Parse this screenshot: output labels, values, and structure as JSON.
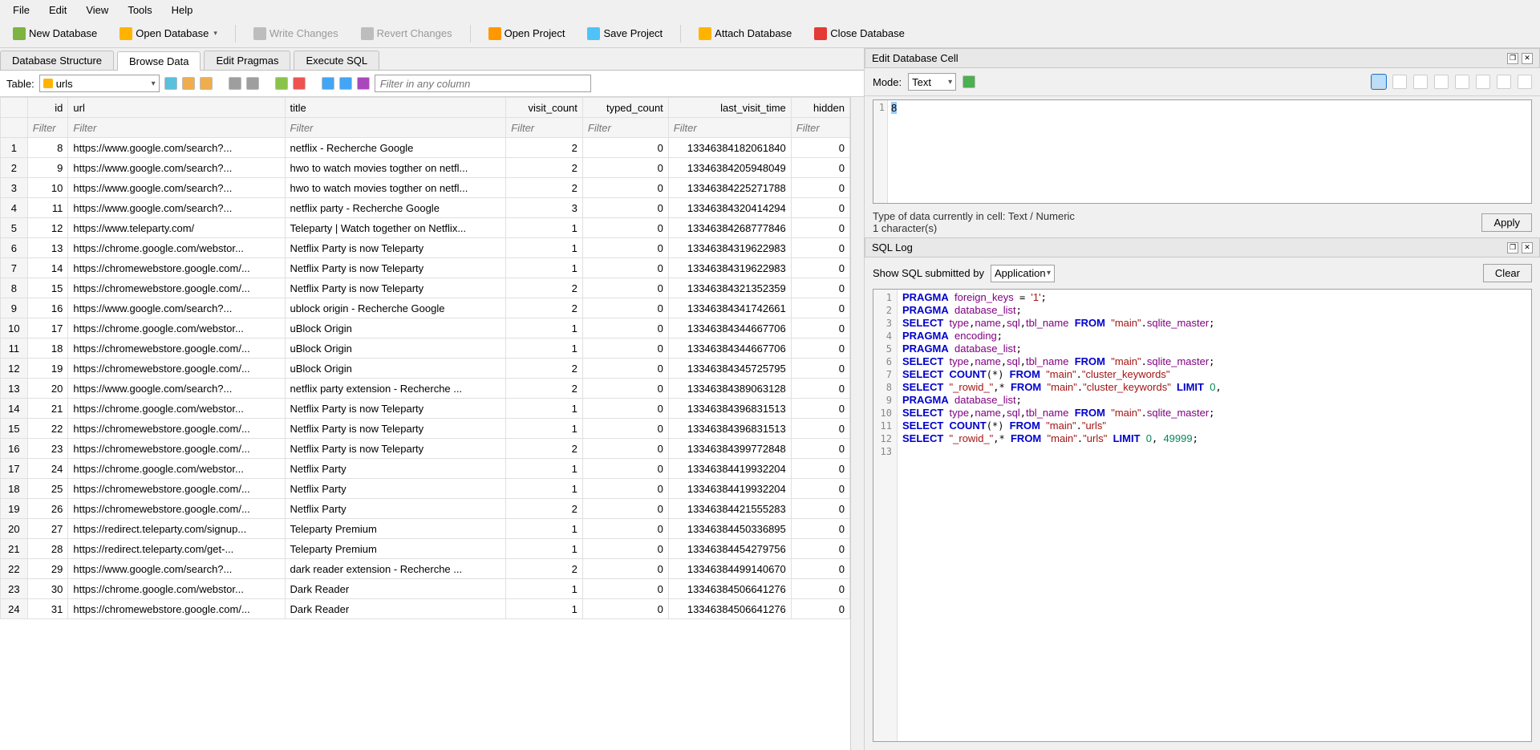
{
  "menu": {
    "file": "File",
    "edit": "Edit",
    "view": "View",
    "tools": "Tools",
    "help": "Help"
  },
  "toolbar": {
    "new_database": "New Database",
    "open_database": "Open Database",
    "write_changes": "Write Changes",
    "revert_changes": "Revert Changes",
    "open_project": "Open Project",
    "save_project": "Save Project",
    "attach_database": "Attach Database",
    "close_database": "Close Database"
  },
  "tabs": {
    "structure": "Database Structure",
    "browse": "Browse Data",
    "pragmas": "Edit Pragmas",
    "sql": "Execute SQL"
  },
  "browse": {
    "table_label": "Table:",
    "table_selected": "urls",
    "filter_any_placeholder": "Filter in any column",
    "headers": {
      "id": "id",
      "url": "url",
      "title": "title",
      "visit_count": "visit_count",
      "typed_count": "typed_count",
      "last_visit_time": "last_visit_time",
      "hidden": "hidden"
    },
    "filter_placeholder": "Filter"
  },
  "rows": [
    {
      "n": 1,
      "id": 8,
      "url": "https://www.google.com/search?...",
      "title": "netflix - Recherche Google",
      "vc": 2,
      "tc": 0,
      "lvt": "13346384182061840",
      "hid": 0
    },
    {
      "n": 2,
      "id": 9,
      "url": "https://www.google.com/search?...",
      "title": "hwo to watch movies togther on netfl...",
      "vc": 2,
      "tc": 0,
      "lvt": "13346384205948049",
      "hid": 0
    },
    {
      "n": 3,
      "id": 10,
      "url": "https://www.google.com/search?...",
      "title": "hwo to watch movies togther on netfl...",
      "vc": 2,
      "tc": 0,
      "lvt": "13346384225271788",
      "hid": 0
    },
    {
      "n": 4,
      "id": 11,
      "url": "https://www.google.com/search?...",
      "title": "netflix party - Recherche Google",
      "vc": 3,
      "tc": 0,
      "lvt": "13346384320414294",
      "hid": 0
    },
    {
      "n": 5,
      "id": 12,
      "url": "https://www.teleparty.com/",
      "title": "Teleparty | Watch together on Netflix...",
      "vc": 1,
      "tc": 0,
      "lvt": "13346384268777846",
      "hid": 0
    },
    {
      "n": 6,
      "id": 13,
      "url": "https://chrome.google.com/webstor...",
      "title": "Netflix Party is now Teleparty",
      "vc": 1,
      "tc": 0,
      "lvt": "13346384319622983",
      "hid": 0
    },
    {
      "n": 7,
      "id": 14,
      "url": "https://chromewebstore.google.com/...",
      "title": "Netflix Party is now Teleparty",
      "vc": 1,
      "tc": 0,
      "lvt": "13346384319622983",
      "hid": 0
    },
    {
      "n": 8,
      "id": 15,
      "url": "https://chromewebstore.google.com/...",
      "title": "Netflix Party is now Teleparty",
      "vc": 2,
      "tc": 0,
      "lvt": "13346384321352359",
      "hid": 0
    },
    {
      "n": 9,
      "id": 16,
      "url": "https://www.google.com/search?...",
      "title": "ublock origin - Recherche Google",
      "vc": 2,
      "tc": 0,
      "lvt": "13346384341742661",
      "hid": 0
    },
    {
      "n": 10,
      "id": 17,
      "url": "https://chrome.google.com/webstor...",
      "title": "uBlock Origin",
      "vc": 1,
      "tc": 0,
      "lvt": "13346384344667706",
      "hid": 0
    },
    {
      "n": 11,
      "id": 18,
      "url": "https://chromewebstore.google.com/...",
      "title": "uBlock Origin",
      "vc": 1,
      "tc": 0,
      "lvt": "13346384344667706",
      "hid": 0
    },
    {
      "n": 12,
      "id": 19,
      "url": "https://chromewebstore.google.com/...",
      "title": "uBlock Origin",
      "vc": 2,
      "tc": 0,
      "lvt": "13346384345725795",
      "hid": 0
    },
    {
      "n": 13,
      "id": 20,
      "url": "https://www.google.com/search?...",
      "title": "netflix party extension - Recherche ...",
      "vc": 2,
      "tc": 0,
      "lvt": "13346384389063128",
      "hid": 0
    },
    {
      "n": 14,
      "id": 21,
      "url": "https://chrome.google.com/webstor...",
      "title": "Netflix Party is now Teleparty",
      "vc": 1,
      "tc": 0,
      "lvt": "13346384396831513",
      "hid": 0
    },
    {
      "n": 15,
      "id": 22,
      "url": "https://chromewebstore.google.com/...",
      "title": "Netflix Party is now Teleparty",
      "vc": 1,
      "tc": 0,
      "lvt": "13346384396831513",
      "hid": 0
    },
    {
      "n": 16,
      "id": 23,
      "url": "https://chromewebstore.google.com/...",
      "title": "Netflix Party is now Teleparty",
      "vc": 2,
      "tc": 0,
      "lvt": "13346384399772848",
      "hid": 0
    },
    {
      "n": 17,
      "id": 24,
      "url": "https://chrome.google.com/webstor...",
      "title": "Netflix Party",
      "vc": 1,
      "tc": 0,
      "lvt": "13346384419932204",
      "hid": 0
    },
    {
      "n": 18,
      "id": 25,
      "url": "https://chromewebstore.google.com/...",
      "title": "Netflix Party",
      "vc": 1,
      "tc": 0,
      "lvt": "13346384419932204",
      "hid": 0
    },
    {
      "n": 19,
      "id": 26,
      "url": "https://chromewebstore.google.com/...",
      "title": "Netflix Party",
      "vc": 2,
      "tc": 0,
      "lvt": "13346384421555283",
      "hid": 0
    },
    {
      "n": 20,
      "id": 27,
      "url": "https://redirect.teleparty.com/signup...",
      "title": "Teleparty Premium",
      "vc": 1,
      "tc": 0,
      "lvt": "13346384450336895",
      "hid": 0
    },
    {
      "n": 21,
      "id": 28,
      "url": "https://redirect.teleparty.com/get-...",
      "title": "Teleparty Premium",
      "vc": 1,
      "tc": 0,
      "lvt": "13346384454279756",
      "hid": 0
    },
    {
      "n": 22,
      "id": 29,
      "url": "https://www.google.com/search?...",
      "title": "dark reader extension - Recherche ...",
      "vc": 2,
      "tc": 0,
      "lvt": "13346384499140670",
      "hid": 0
    },
    {
      "n": 23,
      "id": 30,
      "url": "https://chrome.google.com/webstor...",
      "title": "Dark Reader",
      "vc": 1,
      "tc": 0,
      "lvt": "13346384506641276",
      "hid": 0
    },
    {
      "n": 24,
      "id": 31,
      "url": "https://chromewebstore.google.com/...",
      "title": "Dark Reader",
      "vc": 1,
      "tc": 0,
      "lvt": "13346384506641276",
      "hid": 0
    }
  ],
  "editcell": {
    "title": "Edit Database Cell",
    "mode_label": "Mode:",
    "mode_value": "Text",
    "content": "8",
    "line": "1",
    "type_info": "Type of data currently in cell: Text / Numeric",
    "char_info": "1 character(s)",
    "apply": "Apply"
  },
  "sqllog": {
    "title": "SQL Log",
    "show_label": "Show SQL submitted by",
    "source": "Application",
    "clear": "Clear",
    "lines": [
      {
        "html": "<span class='kw'>PRAGMA</span> <span class='ident'>foreign_keys</span> = <span class='str'>'1'</span>;"
      },
      {
        "html": "<span class='kw'>PRAGMA</span> <span class='ident'>database_list</span>;"
      },
      {
        "html": "<span class='kw'>SELECT</span> <span class='ident'>type</span>,<span class='ident'>name</span>,<span class='ident'>sql</span>,<span class='ident'>tbl_name</span> <span class='kw'>FROM</span> <span class='str'>\"main\"</span>.<span class='ident'>sqlite_master</span>;"
      },
      {
        "html": "<span class='kw'>PRAGMA</span> <span class='ident'>encoding</span>;"
      },
      {
        "html": "<span class='kw'>PRAGMA</span> <span class='ident'>database_list</span>;"
      },
      {
        "html": "<span class='kw'>SELECT</span> <span class='ident'>type</span>,<span class='ident'>name</span>,<span class='ident'>sql</span>,<span class='ident'>tbl_name</span> <span class='kw'>FROM</span> <span class='str'>\"main\"</span>.<span class='ident'>sqlite_master</span>;"
      },
      {
        "html": "<span class='kw'>SELECT</span> <span class='kw'>COUNT</span>(*) <span class='kw'>FROM</span> <span class='str'>\"main\"</span>.<span class='str'>\"cluster_keywords\"</span>"
      },
      {
        "html": "<span class='kw'>SELECT</span> <span class='str'>\"_rowid_\"</span>,* <span class='kw'>FROM</span> <span class='str'>\"main\"</span>.<span class='str'>\"cluster_keywords\"</span> <span class='kw'>LIMIT</span> <span class='num'>0</span>,"
      },
      {
        "html": "<span class='kw'>PRAGMA</span> <span class='ident'>database_list</span>;"
      },
      {
        "html": "<span class='kw'>SELECT</span> <span class='ident'>type</span>,<span class='ident'>name</span>,<span class='ident'>sql</span>,<span class='ident'>tbl_name</span> <span class='kw'>FROM</span> <span class='str'>\"main\"</span>.<span class='ident'>sqlite_master</span>;"
      },
      {
        "html": "<span class='kw'>SELECT</span> <span class='kw'>COUNT</span>(*) <span class='kw'>FROM</span> <span class='str'>\"main\"</span>.<span class='str'>\"urls\"</span>"
      },
      {
        "html": "<span class='kw'>SELECT</span> <span class='str'>\"_rowid_\"</span>,* <span class='kw'>FROM</span> <span class='str'>\"main\"</span>.<span class='str'>\"urls\"</span> <span class='kw'>LIMIT</span> <span class='num'>0</span>, <span class='num'>49999</span>;"
      },
      {
        "html": ""
      }
    ]
  }
}
